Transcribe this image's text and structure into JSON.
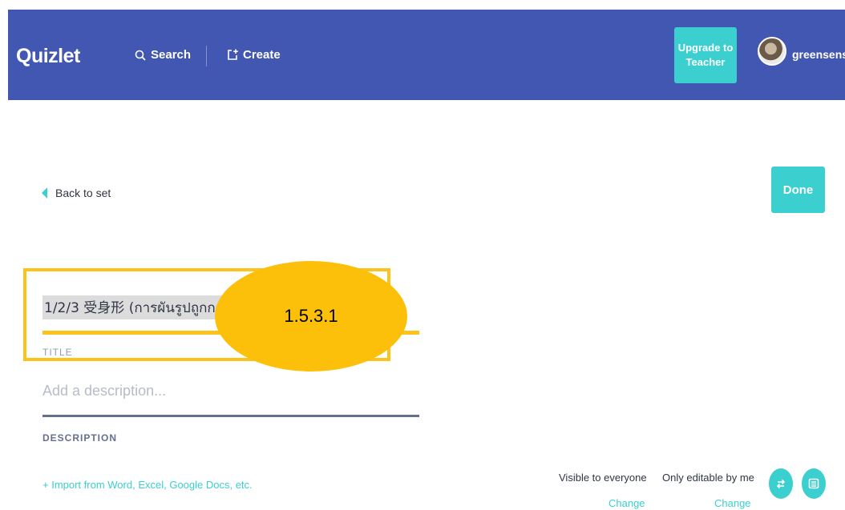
{
  "header": {
    "logo": "Quizlet",
    "search_label": "Search",
    "create_label": "Create",
    "upgrade_line1": "Upgrade to",
    "upgrade_line2": "Teacher",
    "username": "greensensei"
  },
  "nav": {
    "back_label": "Back to set",
    "done_label": "Done"
  },
  "form": {
    "title_value": "1/2/3 受身形 (การผันรูปถูกกระทำ)",
    "title_label": "TITLE",
    "description_placeholder": "Add a description...",
    "description_label": "DESCRIPTION",
    "import_label": "+ Import from Word, Excel, Google Docs, etc."
  },
  "annotation": {
    "label": "1.5.3.1"
  },
  "settings": {
    "visibility_text": "Visible to everyone",
    "visibility_change": "Change",
    "edit_text": "Only editable by me",
    "edit_change": "Change"
  },
  "colors": {
    "header_bg": "#4257b2",
    "accent": "#3ccfcf",
    "highlight": "#fcc31c"
  },
  "icons": {
    "search": "search-icon",
    "create": "create-icon",
    "back": "chevron-left-icon",
    "swap": "swap-icon",
    "list": "list-icon"
  }
}
